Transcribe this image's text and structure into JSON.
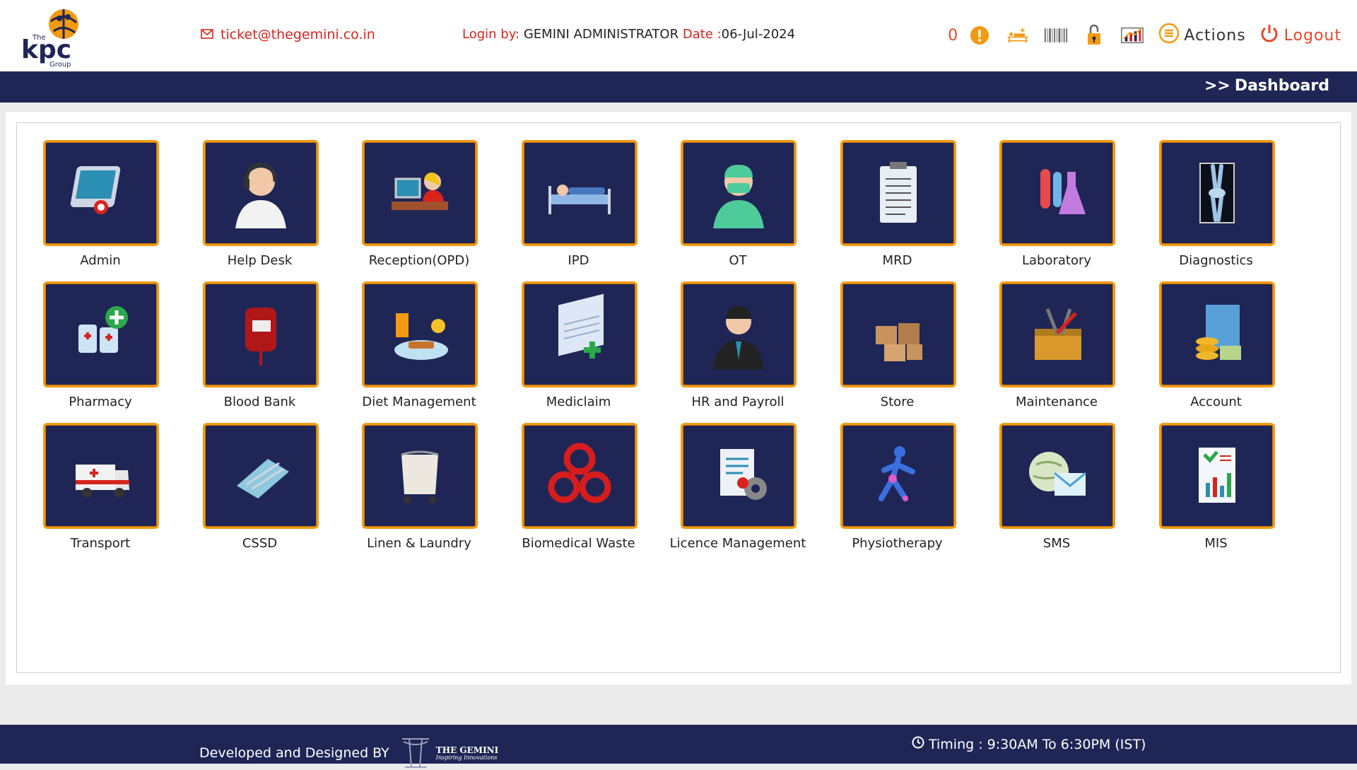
{
  "header": {
    "logo": {
      "top_text": "The",
      "brand": "kpc",
      "sub": "Group"
    },
    "email": "ticket@thegemini.co.in",
    "login_label": "Login by:",
    "login_user": "GEMINI ADMINISTRATOR",
    "date_label": "Date :",
    "date_value": "06-Jul-2024",
    "alert_count": "0",
    "actions_label": "Actions",
    "logout_label": "Logout",
    "tool_icons": [
      "alert-icon",
      "bed-transfer-icon",
      "barcode-icon",
      "padlock-icon",
      "chart-icon"
    ]
  },
  "breadcrumb": {
    "prefix": ">>",
    "current": "Dashboard"
  },
  "modules": [
    {
      "label": "Admin",
      "icon": "admin-tablet-icon"
    },
    {
      "label": "Help Desk",
      "icon": "headset-agent-icon"
    },
    {
      "label": "Reception(OPD)",
      "icon": "receptionist-icon"
    },
    {
      "label": "IPD",
      "icon": "hospital-bed-icon"
    },
    {
      "label": "OT",
      "icon": "surgeon-icon"
    },
    {
      "label": "MRD",
      "icon": "clipboard-record-icon"
    },
    {
      "label": "Laboratory",
      "icon": "lab-flasks-icon"
    },
    {
      "label": "Diagnostics",
      "icon": "xray-icon"
    },
    {
      "label": "Pharmacy",
      "icon": "medicine-bottles-icon"
    },
    {
      "label": "Blood Bank",
      "icon": "blood-bag-icon"
    },
    {
      "label": "Diet Management",
      "icon": "food-plate-icon"
    },
    {
      "label": "Mediclaim",
      "icon": "claim-form-icon"
    },
    {
      "label": "HR and Payroll",
      "icon": "businessman-icon"
    },
    {
      "label": "Store",
      "icon": "boxes-icon"
    },
    {
      "label": "Maintenance",
      "icon": "toolbox-icon"
    },
    {
      "label": "Account",
      "icon": "coins-clipboard-icon"
    },
    {
      "label": "Transport",
      "icon": "ambulance-icon"
    },
    {
      "label": "CSSD",
      "icon": "sterile-instruments-icon"
    },
    {
      "label": "Linen & Laundry",
      "icon": "laundry-cart-icon"
    },
    {
      "label": "Biomedical Waste",
      "icon": "biohazard-icon"
    },
    {
      "label": "Licence Management",
      "icon": "document-gear-icon"
    },
    {
      "label": "Physiotherapy",
      "icon": "body-joints-icon"
    },
    {
      "label": "SMS",
      "icon": "globe-envelope-icon"
    },
    {
      "label": "MIS",
      "icon": "report-chart-icon"
    }
  ],
  "footer": {
    "developed_label": "Developed and Designed BY",
    "company": "THE GEMINI",
    "tagline": "Inspiring Innovations",
    "timing": "Timing : 9:30AM To 6:30PM (IST)"
  },
  "colors": {
    "navy": "#1f2656",
    "orange": "#f39a12",
    "red": "#d9231d"
  }
}
